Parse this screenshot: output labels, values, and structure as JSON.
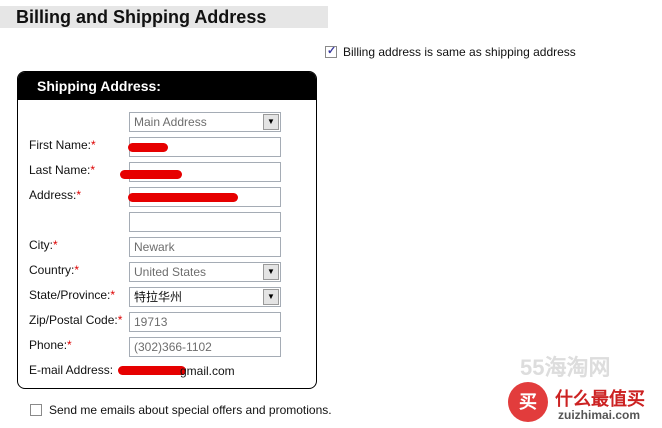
{
  "page": {
    "title": "Billing and Shipping Address"
  },
  "billing_same": {
    "checked": true,
    "label": "Billing address is same as shipping address"
  },
  "shipping": {
    "header": "Shipping Address:",
    "address_select": "Main Address",
    "fields": {
      "first_name": {
        "label": "First Name:",
        "required": "*"
      },
      "last_name": {
        "label": "Last Name:",
        "required": "*"
      },
      "address": {
        "label": "Address:",
        "required": "*"
      },
      "city": {
        "label": "City:",
        "required": "*",
        "value": "Newark"
      },
      "country": {
        "label": "Country:",
        "required": "*",
        "value": "United States"
      },
      "state": {
        "label": "State/Province:",
        "required": "*",
        "value": "特拉华州"
      },
      "zip": {
        "label": "Zip/Postal Code:",
        "required": "*",
        "value": "19713"
      },
      "phone": {
        "label": "Phone:",
        "required": "*",
        "value": "(302)366-1102"
      },
      "email": {
        "label": "E-mail Address:",
        "value_suffix": "gmail.com"
      }
    }
  },
  "promo": {
    "checked": false,
    "label": "Send me emails about special offers and promotions."
  },
  "watermark": {
    "badge": "买",
    "site_cn": "什么最值买",
    "site_en": "zuizhimai.com",
    "faint": "55海淘网"
  },
  "colors": {
    "required": "#dd0000",
    "redaction": "#e60000",
    "panel_header": "#000000"
  }
}
